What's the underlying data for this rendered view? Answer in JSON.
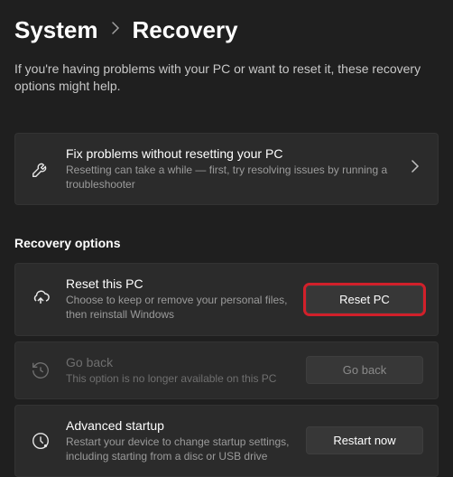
{
  "breadcrumb": {
    "parent": "System",
    "current": "Recovery"
  },
  "intro": "If you're having problems with your PC or want to reset it, these recovery options might help.",
  "fixCard": {
    "title": "Fix problems without resetting your PC",
    "desc": "Resetting can take a while — first, try resolving issues by running a troubleshooter"
  },
  "sectionHeader": "Recovery options",
  "resetCard": {
    "title": "Reset this PC",
    "desc": "Choose to keep or remove your personal files, then reinstall Windows",
    "button": "Reset PC"
  },
  "goBackCard": {
    "title": "Go back",
    "desc": "This option is no longer available on this PC",
    "button": "Go back"
  },
  "advancedCard": {
    "title": "Advanced startup",
    "desc": "Restart your device to change startup settings, including starting from a disc or USB drive",
    "button": "Restart now"
  }
}
